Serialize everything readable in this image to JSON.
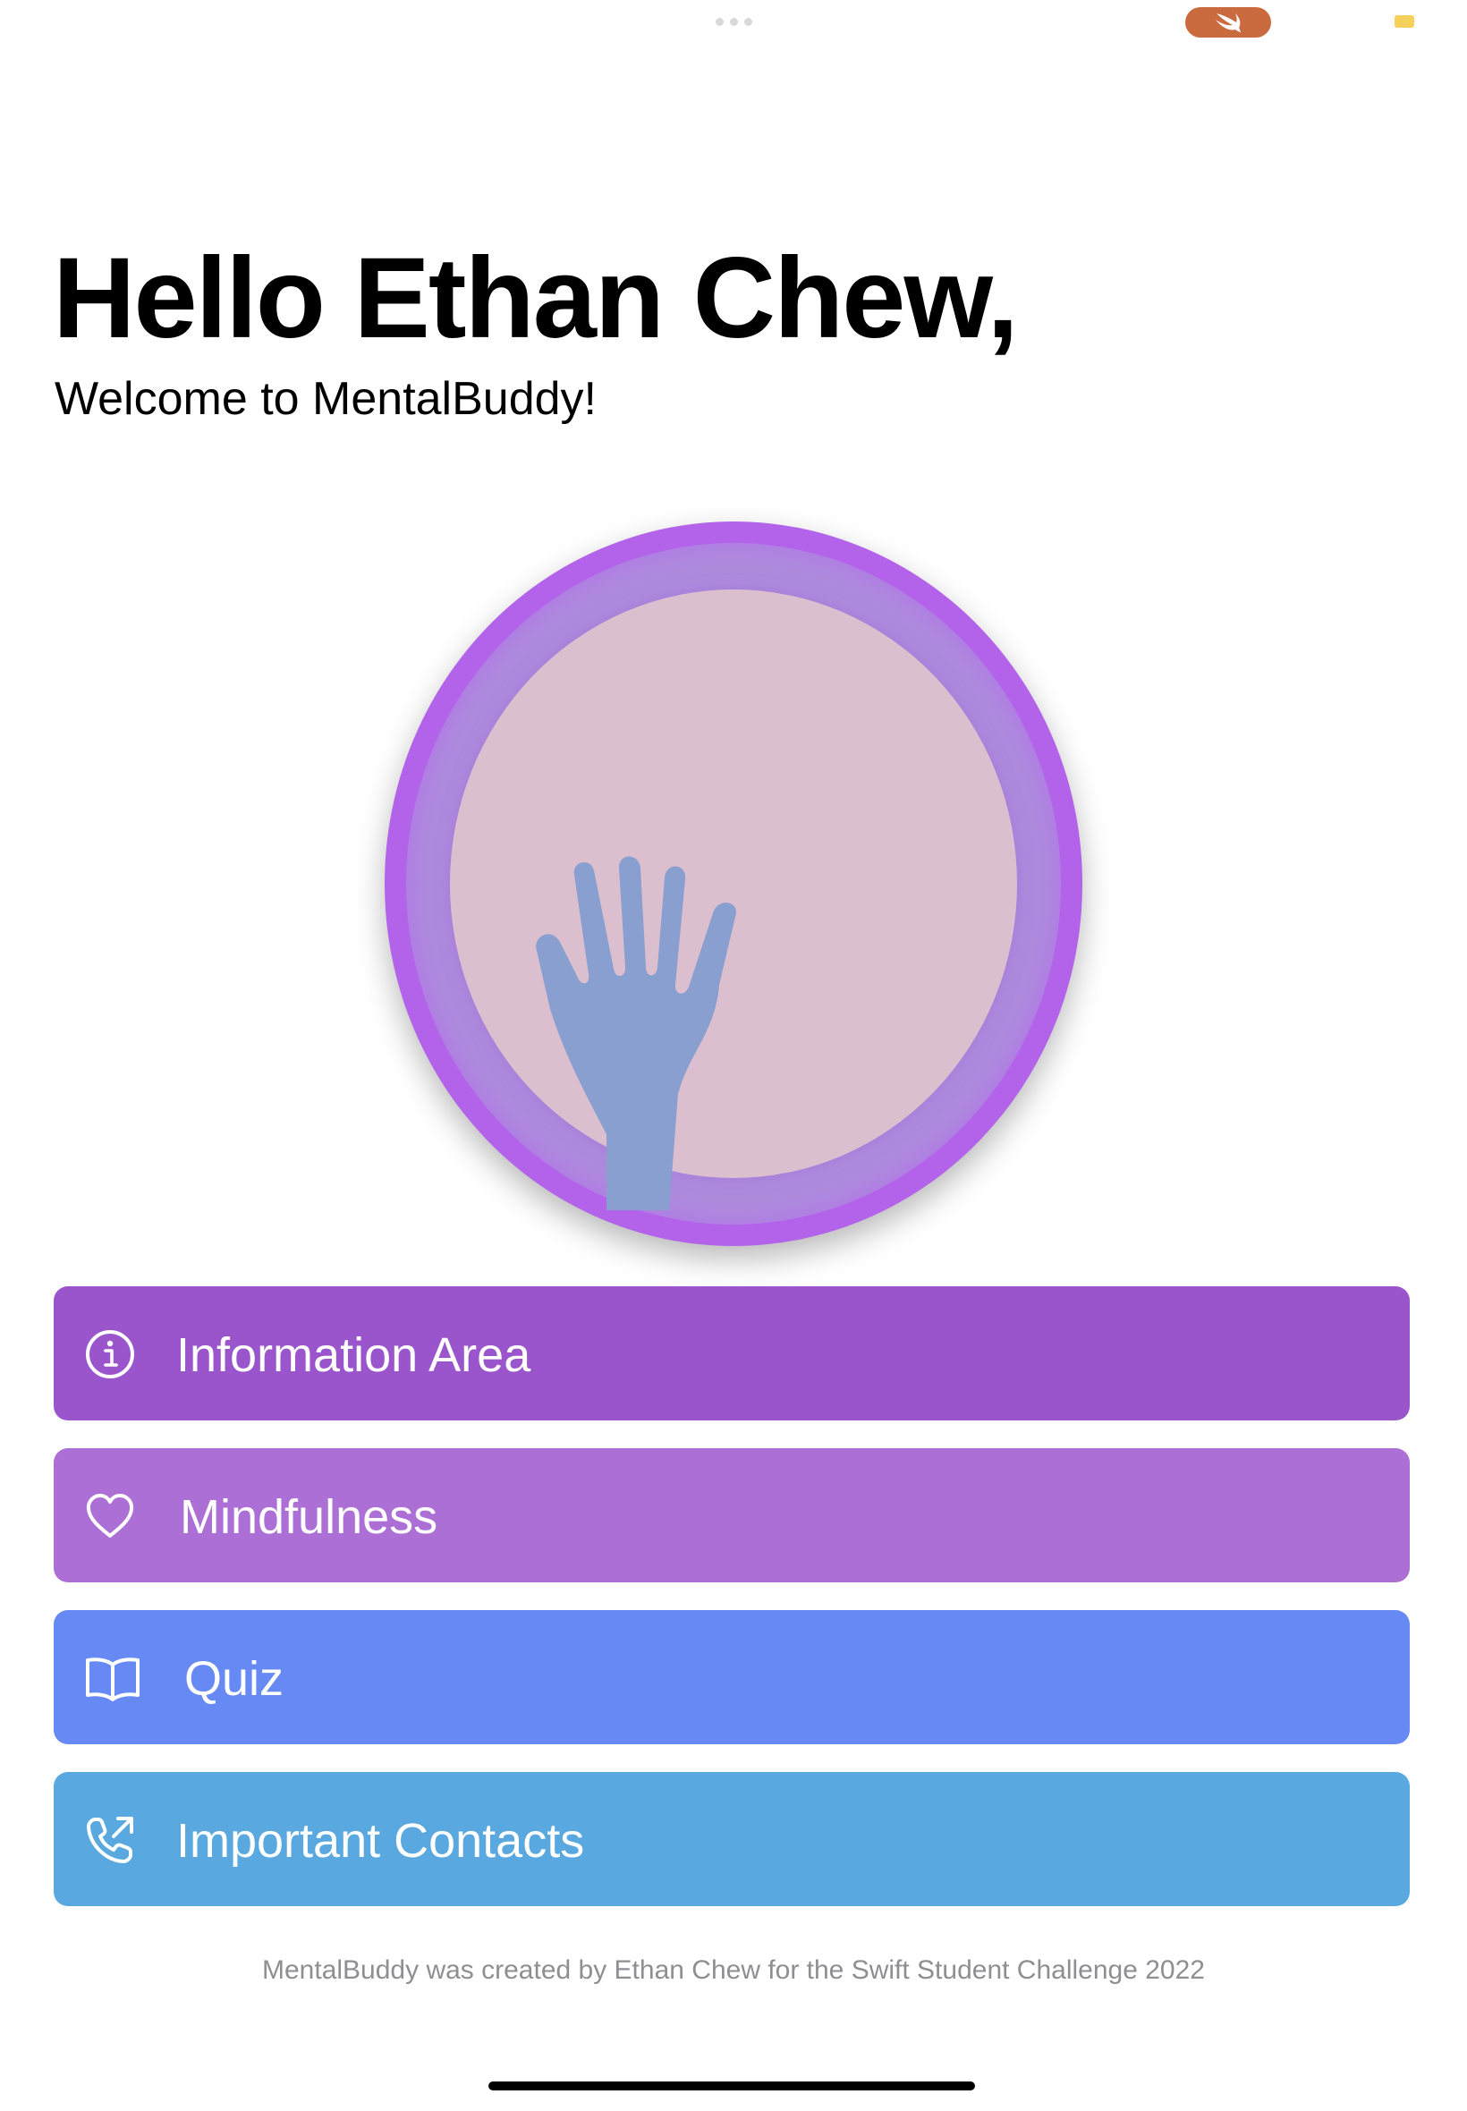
{
  "header": {
    "greeting": "Hello Ethan Chew,",
    "subtitle": "Welcome to MentalBuddy!"
  },
  "logo": {
    "icon": "helping-hands-icon",
    "colors": {
      "outer_ring": "#b363ea",
      "middle_ring": "#ae8bdd",
      "inner_fill": "#dcbfcf",
      "back_hand": "#889fd0",
      "front_hand": "#4678d0"
    }
  },
  "menu": {
    "items": [
      {
        "label": "Information Area",
        "icon": "info-circle-icon",
        "color": "#9b55cc"
      },
      {
        "label": "Mindfulness",
        "icon": "heart-icon",
        "color": "#ac6fd6"
      },
      {
        "label": "Quiz",
        "icon": "book-icon",
        "color": "#6689f3"
      },
      {
        "label": "Important Contacts",
        "icon": "phone-outgoing-icon",
        "color": "#59a8df"
      }
    ]
  },
  "footer": {
    "text": "MentalBuddy was created by Ethan Chew for the Swift Student Challenge 2022"
  },
  "status_bar": {
    "app_indicator": "swift-icon",
    "indicator_color": "#c96a3f",
    "battery_color": "#f5d05a"
  }
}
